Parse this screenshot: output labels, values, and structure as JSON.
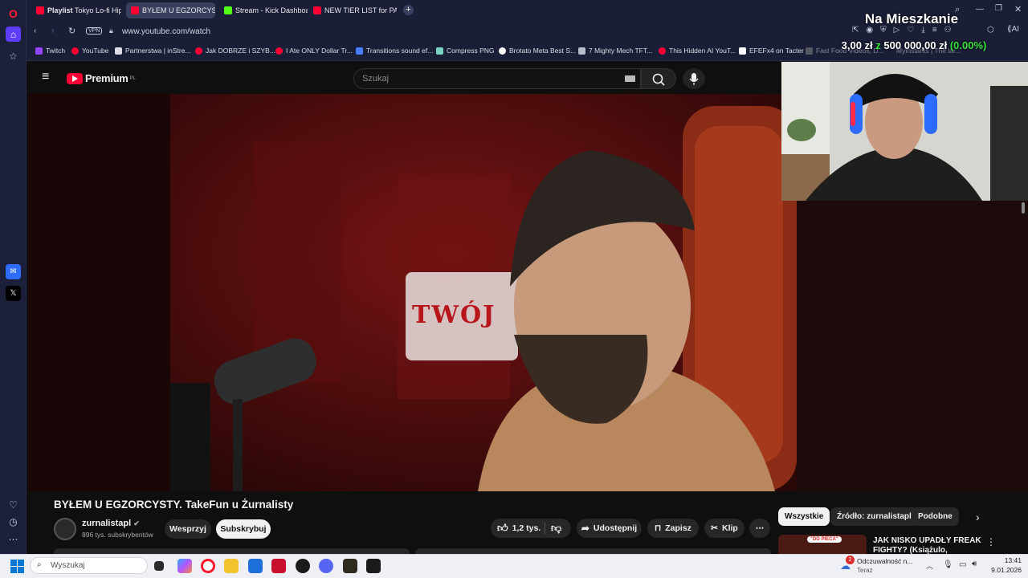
{
  "browser": {
    "tabs": [
      {
        "bold": "Playlist",
        "label": "Tokyo Lo-fi Hiph"
      },
      {
        "bold": "",
        "label": "BYŁEM U EGZORCYST"
      },
      {
        "bold": "",
        "label": "Stream - Kick Dashboard"
      },
      {
        "bold": "",
        "label": "NEW TIER LIST for PATCH"
      }
    ],
    "url": "www.youtube.com/watch",
    "vpn": "VPN",
    "ai": "AI",
    "bookmarks": [
      "Twitch",
      "YouTube",
      "Partnerstwa | inStre...",
      "Jak DOBRZE i SZYB...",
      "I Ate ONLY Dollar Tr...",
      "Transitions sound ef...",
      "Compress PNG",
      "Brotato Meta Best S...",
      "7 Mighty Mech TFT...",
      "This Hidden AI YouT...",
      "EFEFx4 on Tacter",
      "Fast Food Videos, D...",
      "Myinstants | The lar..."
    ]
  },
  "youtube": {
    "logo": "Premium",
    "logo_region": "PL",
    "search_placeholder": "Szukaj",
    "video_title": "BYŁEM U EGZORCYSTY. TakeFun u Żurnalisty",
    "channel_name": "zurnalistapl",
    "subscribers": "896 tys. subskrybentów",
    "support_label": "Wesprzyj",
    "subscribe_label": "Subskrybuj",
    "likes": "1,2 tys.",
    "share_label": "Udostępnij",
    "save_label": "Zapisz",
    "clip_label": "Klip",
    "chips": [
      "Wszystkie",
      "Źródło: zurnalistapl",
      "Podobne"
    ],
    "rec_title": "JAK NISKO UPADŁY FREAK FIGHTY? (Książulo, Żurnalista",
    "rec_badge": "\"DO PIECA\""
  },
  "video": {
    "sign_text": "TWÓJ"
  },
  "stream_overlay": {
    "title": "Na Mieszkanie",
    "amount_current": "3,00 zł",
    "amount_sep": "z",
    "amount_goal": "500 000,00 zł",
    "amount_pct": "(0.00%)"
  },
  "taskbar": {
    "search_placeholder": "Wyszukaj",
    "notification_count": "2",
    "notification_title": "Odczuwalność n...",
    "notification_sub": "Teraz",
    "time": "13:41",
    "date": "9.01.2026"
  },
  "colors": {
    "accent_red": "#ff0033",
    "overlay_green": "#35e03a"
  }
}
